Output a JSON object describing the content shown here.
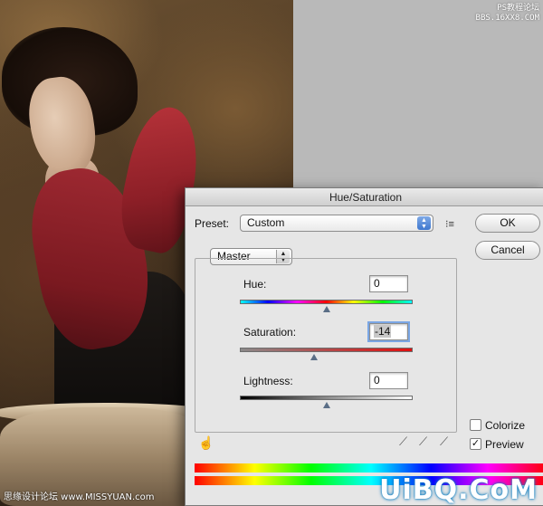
{
  "watermark_top": [
    "PS教程论坛",
    "BBS.16XX8.COM"
  ],
  "watermark_bottom_left": "思缘设计论坛 www.MISSYUAN.com",
  "watermark_bottom_right": "UiBQ.CoM",
  "dialog": {
    "title": "Hue/Saturation",
    "preset_label": "Preset:",
    "preset_value": "Custom",
    "ok_label": "OK",
    "cancel_label": "Cancel",
    "channel_value": "Master",
    "hue": {
      "label": "Hue:",
      "value": "0",
      "slider_position": 0.5
    },
    "saturation": {
      "label": "Saturation:",
      "value": "-14",
      "slider_position": 0.43
    },
    "lightness": {
      "label": "Lightness:",
      "value": "0",
      "slider_position": 0.5
    },
    "colorize_label": "Colorize",
    "colorize_checked": false,
    "preview_label": "Preview",
    "preview_checked": true
  }
}
